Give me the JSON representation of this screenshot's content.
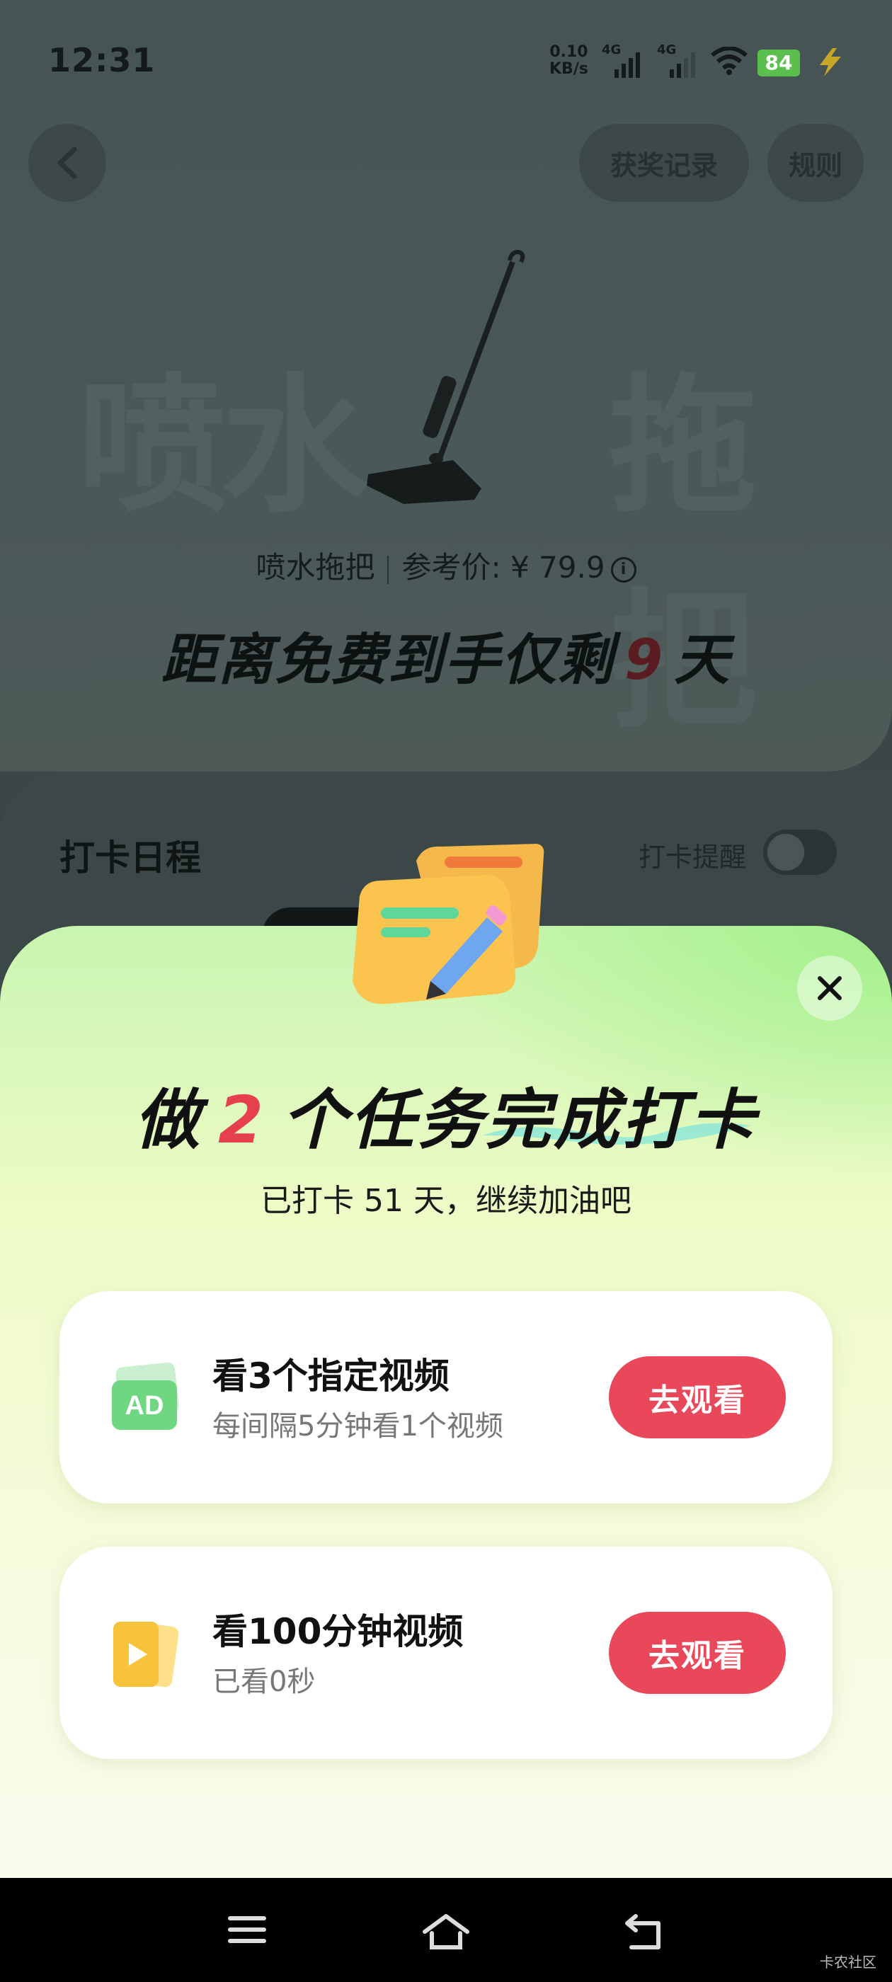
{
  "status_bar": {
    "time": "12:31",
    "net_speed_value": "0.10",
    "net_speed_unit": "KB/s",
    "signal1_label": "4G",
    "signal2_label": "4G",
    "battery": "84"
  },
  "header": {
    "awards_label": "获奖记录",
    "rules_label": "规则"
  },
  "product": {
    "big_left_text": "喷水",
    "big_right_text": "拖把",
    "name": "喷水拖把",
    "price_label": "参考价: ¥ 79.9",
    "countdown_prefix": "距离免费到手仅剩",
    "countdown_days": "9",
    "countdown_suffix": "天"
  },
  "schedule": {
    "title": "打卡日程",
    "remind_label": "打卡提醒",
    "remind_on": false
  },
  "sheet": {
    "headline_prefix": "做",
    "headline_count": "2",
    "headline_mid": "个任务",
    "headline_highlight": "完成打卡",
    "subline": "已打卡 51 天，继续加油吧",
    "tasks": [
      {
        "icon": "ad-icon",
        "icon_text": "AD",
        "title": "看3个指定视频",
        "desc": "每间隔5分钟看1个视频",
        "button": "去观看"
      },
      {
        "icon": "video-play-icon",
        "title": "看100分钟视频",
        "desc": "已看0秒",
        "button": "去观看"
      }
    ]
  },
  "watermark": "卡农社区",
  "colors": {
    "accent_red": "#e9475a",
    "highlight_number": "#e6404e",
    "sheet_green": "#a3f08b"
  }
}
